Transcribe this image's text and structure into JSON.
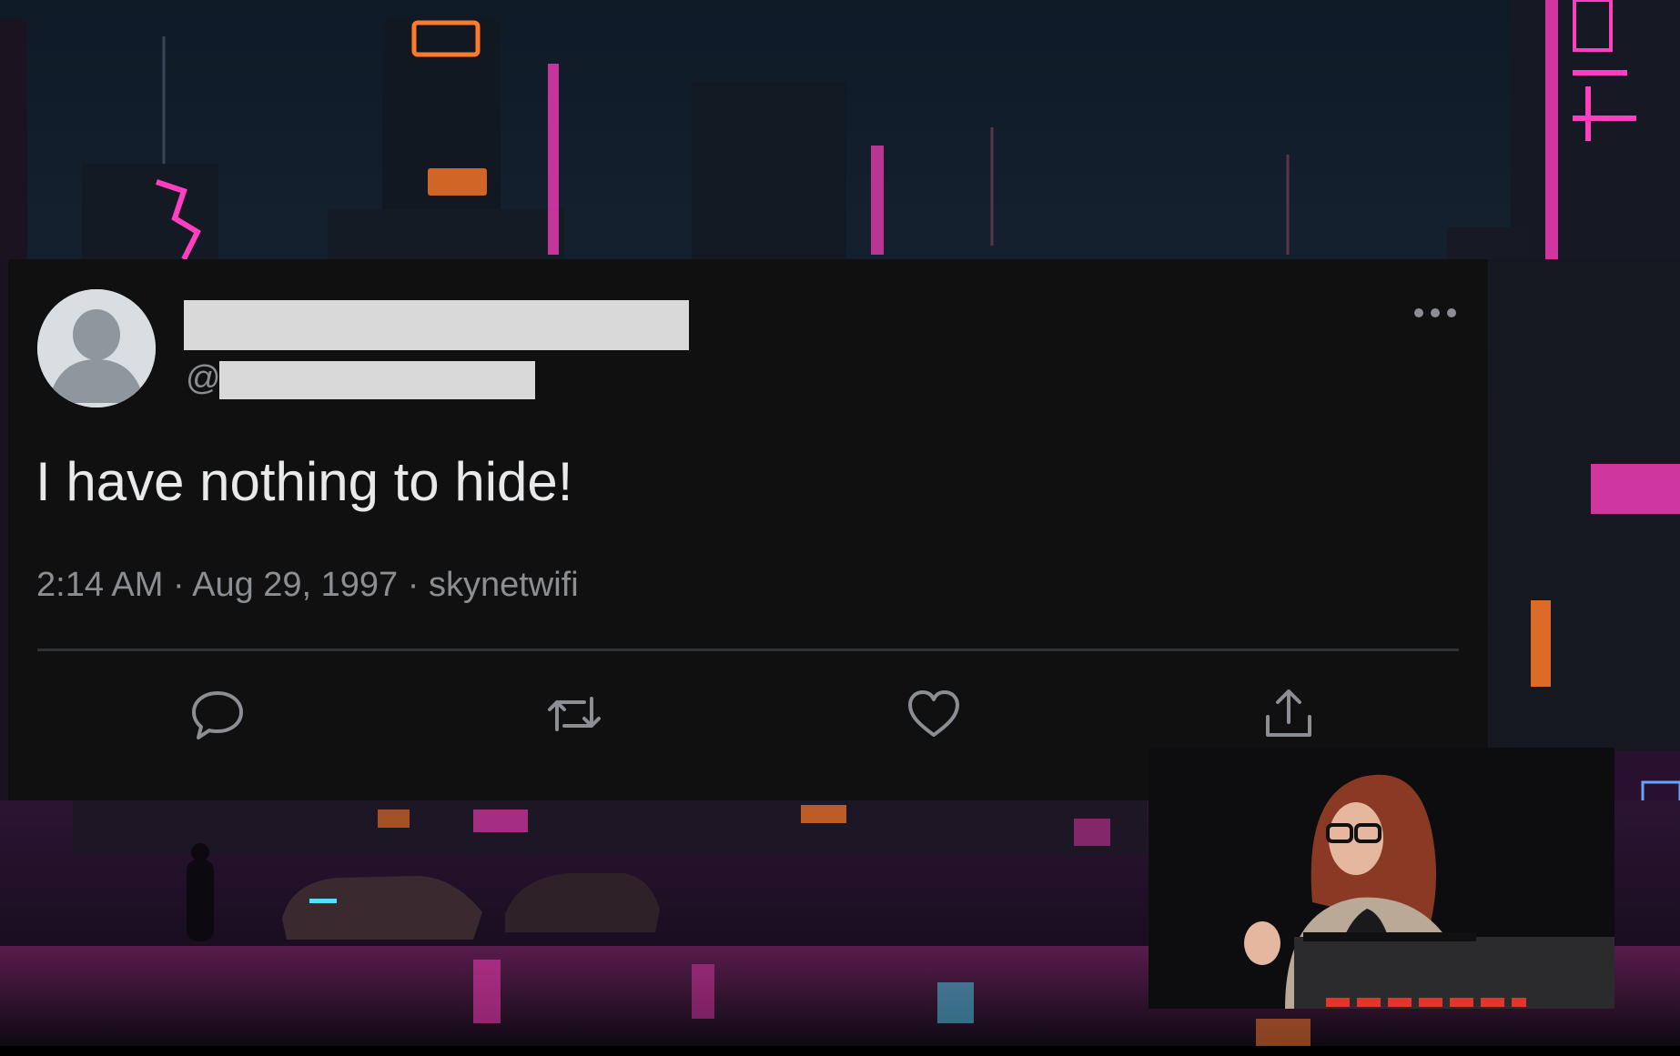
{
  "tweet": {
    "handle_prefix": "@",
    "text": "I have nothing to hide!",
    "meta": "2:14 AM · Aug 29, 1997 · skynetwifi"
  },
  "actions": [
    {
      "icon": "reply-icon"
    },
    {
      "icon": "retweet-icon"
    },
    {
      "icon": "like-icon"
    },
    {
      "icon": "share-icon"
    }
  ],
  "colors": {
    "card_background": "#101010",
    "text_primary": "#e7e9ea",
    "text_secondary": "#8b8e92",
    "redaction": "#d9d9d9",
    "neon_pink": "#ff3fbf",
    "neon_orange": "#ff7a2a"
  }
}
